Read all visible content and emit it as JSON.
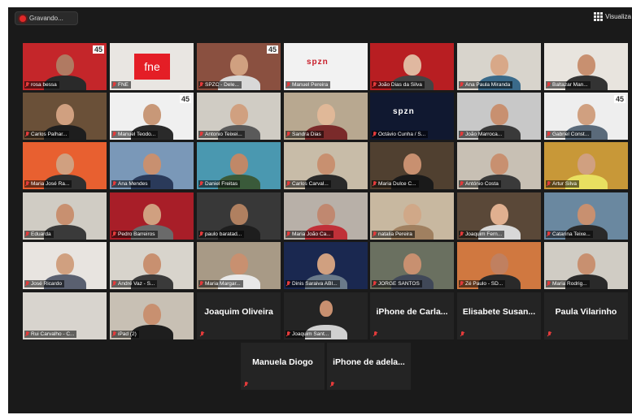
{
  "recording": {
    "label": "Gravando..."
  },
  "view": {
    "label": "Visualiza"
  },
  "participants": [
    {
      "name": "rosa bessa",
      "scene": "#c4262a",
      "skin": "#b07a62",
      "shirt": "#2a2a2a",
      "badge": "45"
    },
    {
      "name": "FNE",
      "scene": "#e9e6e2",
      "logo": "fne"
    },
    {
      "name": "SPZC - Dele...",
      "scene": "#8a5040",
      "skin": "#d0a080",
      "shirt": "#d8d8d8",
      "badge": "45"
    },
    {
      "name": "Manuel Pereira",
      "scene": "#f2f2f2",
      "logo": "spzn-red"
    },
    {
      "name": "João Dias da Silva",
      "scene": "#b81e22",
      "skin": "#e0b8a0",
      "shirt": "#444444"
    },
    {
      "name": "Ana Paula Miranda",
      "scene": "#d8d4cc",
      "skin": "#d8a888",
      "shirt": "#3a6a8a"
    },
    {
      "name": "Baltazar Man...",
      "scene": "#e8e4de",
      "skin": "#c89070",
      "shirt": "#333333"
    },
    {
      "name": "Carlos Palhar...",
      "scene": "#6a5038",
      "skin": "#d0a080",
      "shirt": "#1e1e1e"
    },
    {
      "name": "Manuel Teodo...",
      "scene": "#f0f0f0",
      "skin": "#c89878",
      "shirt": "#2a2a2a",
      "badge": "45"
    },
    {
      "name": "Antonio Teixei...",
      "scene": "#d0ccc4",
      "skin": "#d0a080",
      "shirt": "#5a5a5a"
    },
    {
      "name": "Sandra Dias",
      "scene": "#b8a890",
      "skin": "#e0b898",
      "shirt": "#7a2a2a"
    },
    {
      "name": "Octávio Cunha / S...",
      "scene": "#101830",
      "logo": "spzn-dark"
    },
    {
      "name": "João Marroca...",
      "scene": "#c8c8c8",
      "skin": "#c89070",
      "shirt": "#3a3a3a"
    },
    {
      "name": "Gabriel Const...",
      "scene": "#eeeeee",
      "skin": "#d0a080",
      "shirt": "#5a6a7a",
      "badge": "45"
    },
    {
      "name": "Maria José Ra...",
      "scene": "#e86030",
      "skin": "#d0a080",
      "shirt": "#303030"
    },
    {
      "name": "Ana Mendes",
      "scene": "#7a98b8",
      "skin": "#c89070",
      "shirt": "#2a3a5a"
    },
    {
      "name": "Daniel Freitas",
      "scene": "#4a98b0",
      "skin": "#c08868",
      "shirt": "#3a5a3a"
    },
    {
      "name": "Carlos Carval...",
      "scene": "#c8bca8",
      "skin": "#c89070",
      "shirt": "#2a2a2a"
    },
    {
      "name": "Maria Dulce C...",
      "scene": "#504030",
      "skin": "#c89070",
      "shirt": "#1a1a1a"
    },
    {
      "name": "António Costa",
      "scene": "#c8c0b4",
      "skin": "#c89070",
      "shirt": "#3a3a3a"
    },
    {
      "name": "Artur Silva",
      "scene": "#c89838",
      "skin": "#d0a080",
      "shirt": "#e8e060"
    },
    {
      "name": "Eduarda",
      "scene": "#d0ccc4",
      "skin": "#c89070",
      "shirt": "#3a3a3a"
    },
    {
      "name": "Pedro Barreiros",
      "scene": "#a81e28",
      "skin": "#d0a080",
      "shirt": "#6a6a6a"
    },
    {
      "name": "paulo baratad...",
      "scene": "#383838",
      "skin": "#b08060",
      "shirt": "#1e1e1e"
    },
    {
      "name": "Maria João Ca...",
      "scene": "#b8b0a8",
      "skin": "#c08870",
      "shirt": "#c03038"
    },
    {
      "name": "natalia Pereira",
      "scene": "#c8b8a0",
      "skin": "#d0a888",
      "shirt": "#a08060"
    },
    {
      "name": "Joaquim Fern...",
      "scene": "#5a4838",
      "skin": "#e0b090",
      "shirt": "#d8d8d8"
    },
    {
      "name": "Catarina Teixe...",
      "scene": "#6a88a0",
      "skin": "#c89070",
      "shirt": "#2a2a2a"
    },
    {
      "name": "José Ricardo",
      "scene": "#e8e4e0",
      "skin": "#d0a080",
      "shirt": "#5a6070"
    },
    {
      "name": "André Vaz - S...",
      "scene": "#d8d4cc",
      "skin": "#c89070",
      "shirt": "#3a3a3a"
    },
    {
      "name": "Maria Margar...",
      "scene": "#a89a86",
      "skin": "#c89070",
      "shirt": "#e8e8e8"
    },
    {
      "name": "Dinis Saraiva ABI...",
      "scene": "#1a2850",
      "skin": "#d0a080",
      "shirt": "#6a7a8a"
    },
    {
      "name": "JORGE SANTOS",
      "scene": "#6a7060",
      "skin": "#c89070",
      "shirt": "#404858",
      "highlight": true
    },
    {
      "name": "Zé Paulo - SD...",
      "scene": "#d07840",
      "skin": "#c08060",
      "shirt": "#2a2a2a"
    },
    {
      "name": "Maria Rodrig...",
      "scene": "#d0ccc4",
      "skin": "#c89070",
      "shirt": "#2a2a2a"
    },
    {
      "name": "Rui Carvalho - C...",
      "scene": "#d8d4ce"
    },
    {
      "name": "iPad (2)",
      "scene": "#c8c0b4",
      "skin": "#c89070",
      "shirt": "#1e1e1e"
    },
    {
      "name": "Joaquim Oliveira",
      "textonly": true
    },
    {
      "name": "Joaquim Sant...",
      "scene": "#242424",
      "skin": "#c89070",
      "shirt": "#d0d0d0",
      "small": true
    },
    {
      "name": "iPhone de Carla...",
      "textonly": true
    },
    {
      "name": "Elisabete Susan...",
      "textonly": true
    },
    {
      "name": "Paula Vilarinho",
      "textonly": true
    },
    {
      "name": "Manuela Diogo",
      "textonly": true
    },
    {
      "name": "iPhone de adela...",
      "textonly": true
    }
  ]
}
